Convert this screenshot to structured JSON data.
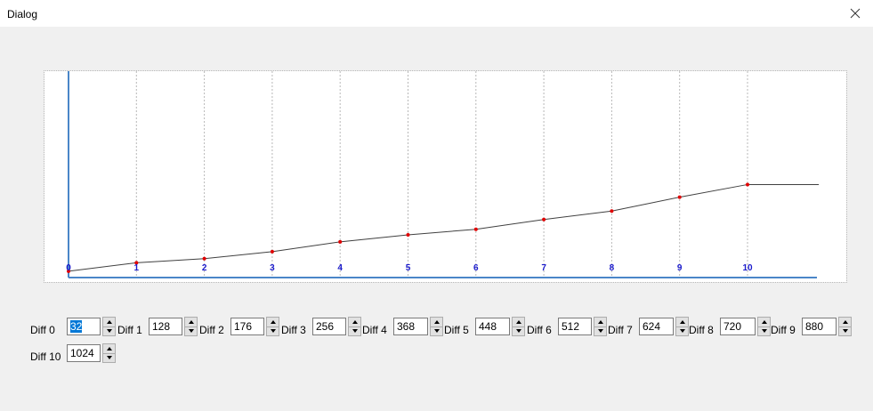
{
  "window": {
    "title": "Dialog",
    "close_icon": "close-icon"
  },
  "chart_data": {
    "type": "line",
    "x_ticks": [
      "0",
      "1",
      "2",
      "3",
      "4",
      "5",
      "6",
      "7",
      "8",
      "9",
      "10"
    ],
    "x": [
      0,
      1,
      2,
      3,
      4,
      5,
      6,
      7,
      8,
      9,
      10
    ],
    "values": [
      32,
      128,
      176,
      256,
      368,
      448,
      512,
      624,
      720,
      880,
      1024
    ],
    "extends_to_x": 11.05,
    "ylim": [
      0,
      2900
    ],
    "grid": "vertical-dotted",
    "line_color": "#404040",
    "point_color": "#e00000",
    "axis_color": "#4a86c8",
    "tick_label_color": "#1a1acc"
  },
  "diffs": [
    {
      "label": "Diff 0",
      "value": "32",
      "focused": true
    },
    {
      "label": "Diff 1",
      "value": "128"
    },
    {
      "label": "Diff 2",
      "value": "176"
    },
    {
      "label": "Diff 3",
      "value": "256"
    },
    {
      "label": "Diff 4",
      "value": "368"
    },
    {
      "label": "Diff 5",
      "value": "448"
    },
    {
      "label": "Diff 6",
      "value": "512"
    },
    {
      "label": "Diff 7",
      "value": "624"
    },
    {
      "label": "Diff 8",
      "value": "720"
    },
    {
      "label": "Diff 9",
      "value": "880"
    },
    {
      "label": "Diff 10",
      "value": "1024"
    }
  ]
}
